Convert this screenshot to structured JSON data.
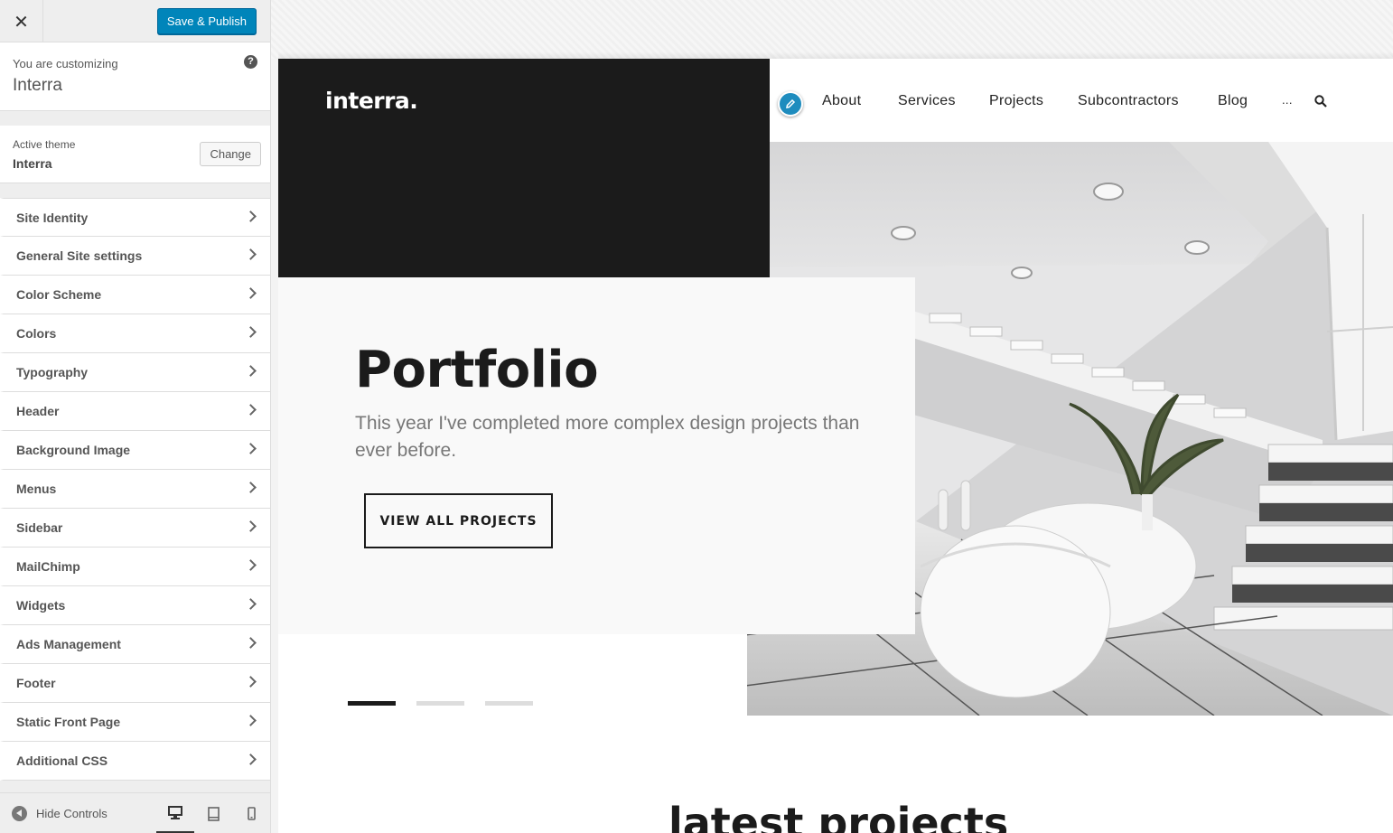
{
  "sidebar": {
    "close_icon": "close-icon",
    "save_label": "Save & Publish",
    "customizing_label": "You are customizing",
    "customizing_title": "Interra",
    "help_symbol": "?",
    "active_theme_label": "Active theme",
    "active_theme_name": "Interra",
    "change_label": "Change",
    "sections": [
      {
        "label": "Site Identity"
      },
      {
        "label": "General Site settings"
      },
      {
        "label": "Color Scheme"
      },
      {
        "label": "Colors"
      },
      {
        "label": "Typography"
      },
      {
        "label": "Header"
      },
      {
        "label": "Background Image"
      },
      {
        "label": "Menus"
      },
      {
        "label": "Sidebar"
      },
      {
        "label": "MailChimp"
      },
      {
        "label": "Widgets"
      },
      {
        "label": "Ads Management"
      },
      {
        "label": "Footer"
      },
      {
        "label": "Static Front Page"
      },
      {
        "label": "Additional CSS"
      }
    ],
    "hide_controls_label": "Hide Controls",
    "active_device": "desktop"
  },
  "preview": {
    "logo": "interra.",
    "nav": {
      "items": [
        "About",
        "Services",
        "Projects",
        "Subcontractors",
        "Blog",
        "..."
      ]
    },
    "hero": {
      "title": "Portfolio",
      "text": "This year I've completed more complex design projects than ever before.",
      "button_label": "VIEW ALL PROJECTS",
      "slide_count": 3,
      "active_slide": 1
    },
    "section_title": "latest projects"
  },
  "colors": {
    "accent": "#0085ba",
    "dark": "#1b1b1b",
    "edit_pencil": "#1e8cbe"
  }
}
